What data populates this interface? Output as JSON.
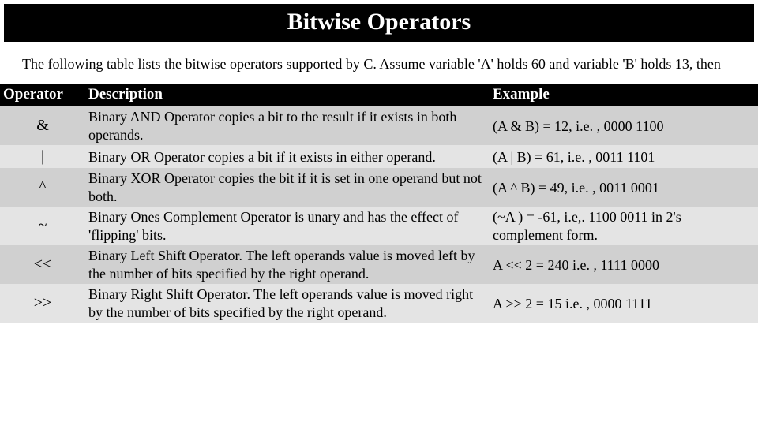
{
  "title": "Bitwise Operators",
  "intro": "The following table lists the bitwise operators supported by C. Assume variable 'A' holds 60 and variable 'B' holds 13, then",
  "headers": {
    "operator": "Operator",
    "description": "Description",
    "example": "Example"
  },
  "rows": [
    {
      "operator": "&",
      "description": "Binary AND Operator copies a bit to the result if it exists in both operands.",
      "example": "(A & B) = 12, i.e. , 0000 1100"
    },
    {
      "operator": "|",
      "description": "Binary OR Operator copies a bit if it exists in either operand.",
      "example": "(A | B) = 61, i.e. , 0011 1101"
    },
    {
      "operator": "^",
      "description": "Binary XOR Operator copies the bit if it is set in one operand but not both.",
      "example": "(A ^ B) = 49, i.e. , 0011 0001"
    },
    {
      "operator": "~",
      "description": "Binary Ones Complement Operator is unary and has the effect of 'flipping' bits.",
      "example": "(~A ) = -61, i.e,. 1100 0011 in 2's complement form."
    },
    {
      "operator": "<<",
      "description": "Binary Left Shift Operator. The left operands value is moved left by the number of bits specified by the right operand.",
      "example": "A << 2 = 240 i.e. , 1111 0000"
    },
    {
      "operator": ">>",
      "description": "Binary Right Shift Operator. The left operands value is moved right by the number of bits specified by the right operand.",
      "example": "A >> 2 = 15 i.e. , 0000 1111"
    }
  ]
}
